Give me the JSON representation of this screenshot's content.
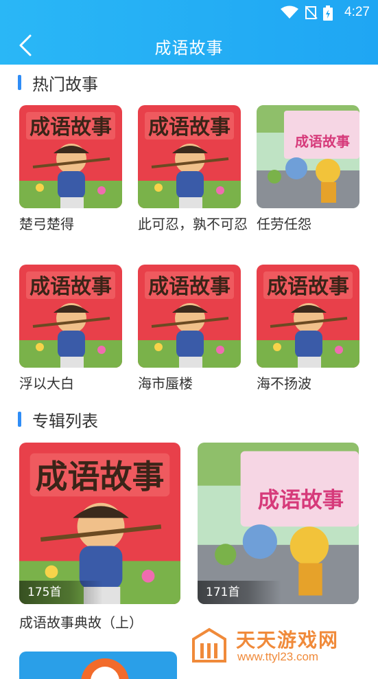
{
  "status": {
    "time": "4:27"
  },
  "header": {
    "title": "成语故事"
  },
  "hot": {
    "heading": "热门故事",
    "items": [
      {
        "title": "楚弓楚得",
        "cover": "red"
      },
      {
        "title": "此可忍，孰不可忍",
        "cover": "red"
      },
      {
        "title": "任劳任怨",
        "cover": "scene"
      },
      {
        "title": "浮以大白",
        "cover": "red"
      },
      {
        "title": "海市蜃楼",
        "cover": "red"
      },
      {
        "title": "海不扬波",
        "cover": "red"
      }
    ]
  },
  "albums": {
    "heading": "专辑列表",
    "items": [
      {
        "title": "成语故事典故（上）",
        "count": "175首",
        "cover": "red"
      },
      {
        "title": "",
        "count": "171首",
        "cover": "scene"
      }
    ]
  },
  "watermark": {
    "brand": "天天游戏网",
    "url": "www.ttyl23.com"
  },
  "colors": {
    "header": "#1fa6f3",
    "accent": "#2f8df6",
    "cover_red": "#e8404a"
  }
}
